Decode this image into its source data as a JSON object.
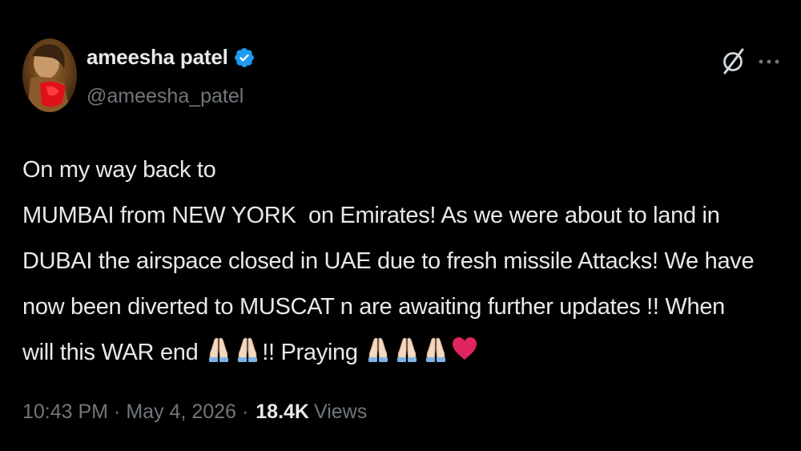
{
  "author": {
    "display_name": "ameesha patel",
    "handle": "@ameesha_patel",
    "verified": true,
    "verified_color": "#1d9bf0"
  },
  "tweet": {
    "line1": "On my way back to",
    "line2": "MUMBAI from NEW YORK  on Emirates! As we were about to land in",
    "line3": "DUBAI the airspace closed in UAE due to fresh missile Attacks! We have",
    "line4": "now been diverted to MUSCAT n are awaiting further updates !! When",
    "line5_a": "will this WAR end ",
    "line5_b": "!! Praying ",
    "emoji_names": [
      "folded-hands",
      "folded-hands",
      "folded-hands",
      "folded-hands",
      "folded-hands",
      "red-heart"
    ]
  },
  "meta": {
    "time": "10:43 PM",
    "separator": "·",
    "date": "May 4, 2026",
    "separator2": "·",
    "views_count": "18.4K",
    "views_label": "Views"
  },
  "icons": {
    "grok": "grok-icon",
    "more": "more-dots-icon"
  },
  "colors": {
    "background": "#000000",
    "text": "#e7e9ea",
    "secondary": "#71767b",
    "heart": "#e0245e"
  }
}
